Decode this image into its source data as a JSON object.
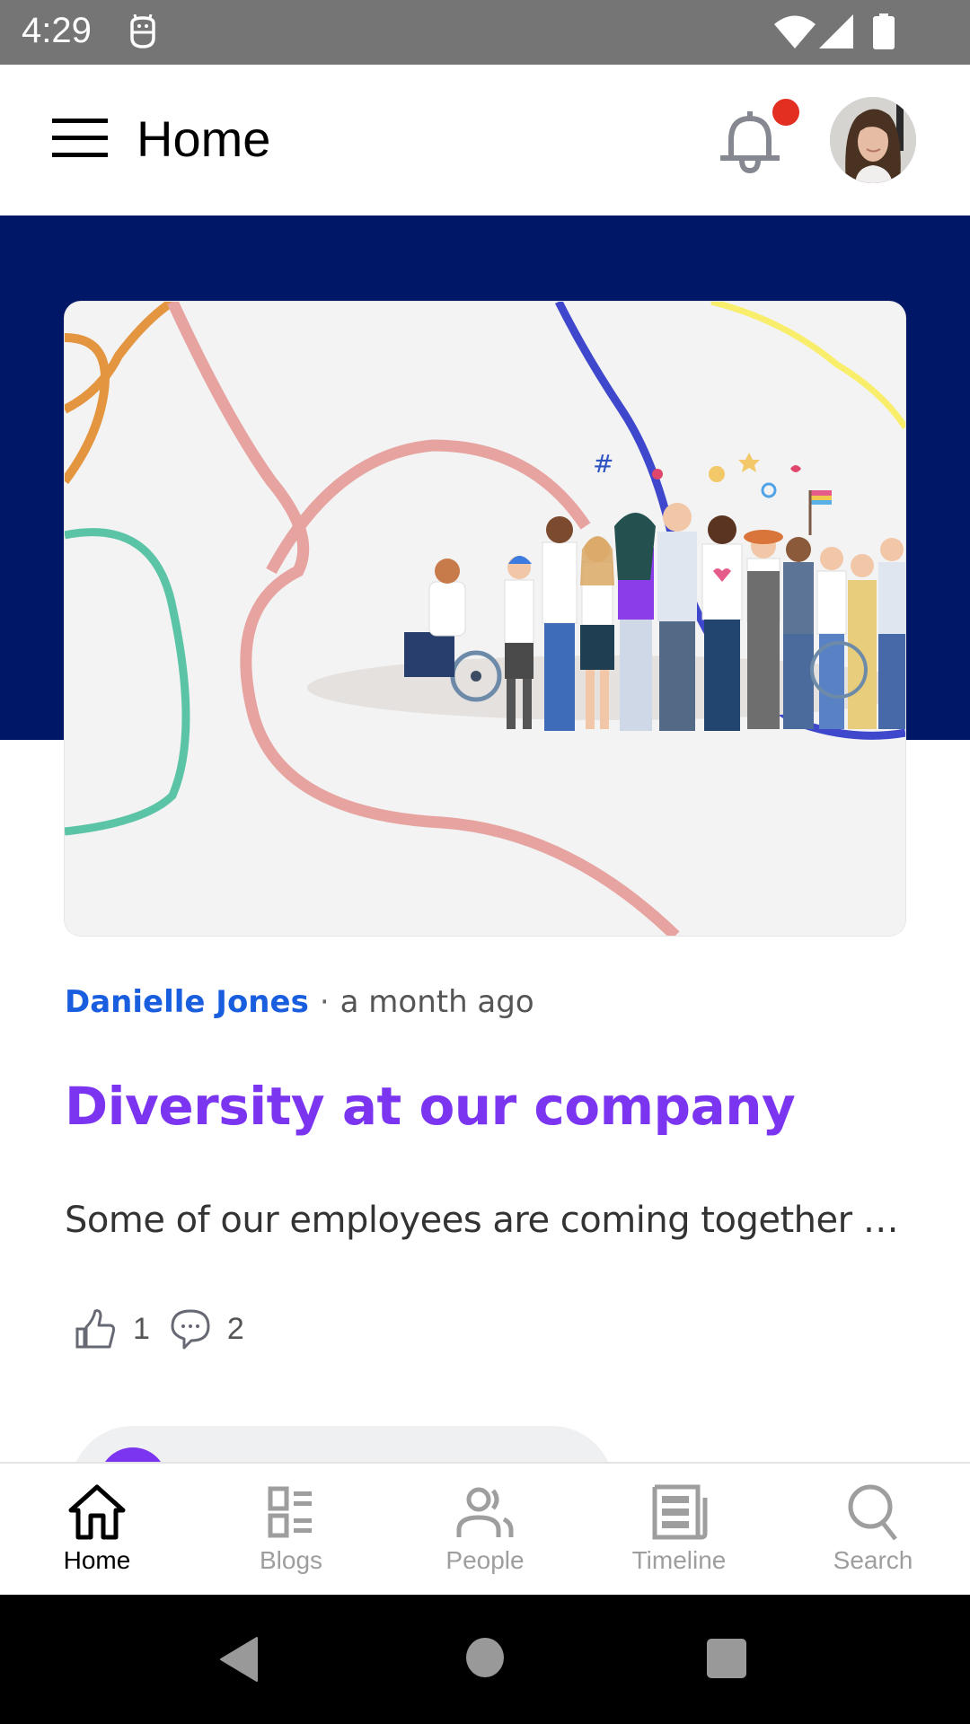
{
  "status_bar": {
    "time": "4:29",
    "icons": [
      "app-notification-icon",
      "wifi-icon",
      "cellular-signal-icon",
      "battery-icon"
    ]
  },
  "app_bar": {
    "title": "Home",
    "menu_icon": "hamburger-menu-icon",
    "notification_icon": "bell-icon",
    "has_unread_notifications": true,
    "unread_dot_color": "#e32f22",
    "avatar": "user-avatar"
  },
  "hero": {
    "background_color": "#001666",
    "image_description": "Illustration of a diverse group of people celebrating with colorful ribbons and a pride flag"
  },
  "post": {
    "author": "Danielle Jones",
    "separator": "·",
    "time_ago": "a month ago",
    "title": "Diversity at our company",
    "excerpt": "Some of our employees are coming together t...",
    "likes": "1",
    "comments": "2",
    "author_color": "#1a5ee0",
    "title_color": "#7b35f0"
  },
  "bottom_nav": {
    "items": [
      {
        "label": "Home",
        "icon": "home-icon",
        "active": true
      },
      {
        "label": "Blogs",
        "icon": "blogs-grid-icon",
        "active": false
      },
      {
        "label": "People",
        "icon": "people-icon",
        "active": false
      },
      {
        "label": "Timeline",
        "icon": "newspaper-icon",
        "active": false
      },
      {
        "label": "Search",
        "icon": "search-icon",
        "active": false
      }
    ]
  },
  "system_nav": {
    "buttons": [
      "back",
      "home",
      "recents"
    ]
  }
}
